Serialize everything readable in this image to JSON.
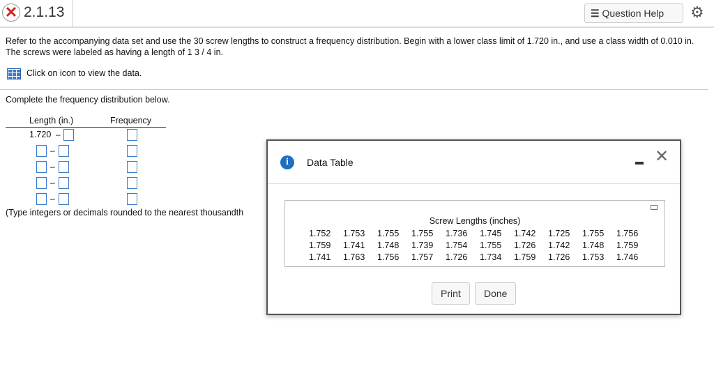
{
  "header": {
    "question_number": "2.1.13",
    "help_label": "Question Help"
  },
  "question": {
    "text": "Refer to the accompanying data set and use the 30 screw lengths to construct a frequency distribution. Begin with a lower class limit of 1.720 in., and use a class width of 0.010 in. The screws were labeled as having a length of 1 3 / 4 in.",
    "data_link": "Click on icon to view the data.",
    "instruction": "Complete the frequency distribution below.",
    "col_length": "Length (in.)",
    "col_frequency": "Frequency",
    "first_lower": "1.720",
    "dash": "–",
    "note": "(Type integers or decimals rounded to the nearest thousandth"
  },
  "dialog": {
    "title": "Data Table",
    "table_title": "Screw Lengths (inches)",
    "rows": [
      [
        "1.752",
        "1.753",
        "1.755",
        "1.755",
        "1.736",
        "1.745",
        "1.742",
        "1.725",
        "1.755",
        "1.756"
      ],
      [
        "1.759",
        "1.741",
        "1.748",
        "1.739",
        "1.754",
        "1.755",
        "1.726",
        "1.742",
        "1.748",
        "1.759"
      ],
      [
        "1.741",
        "1.763",
        "1.756",
        "1.757",
        "1.726",
        "1.734",
        "1.759",
        "1.726",
        "1.753",
        "1.746"
      ]
    ],
    "print_label": "Print",
    "done_label": "Done"
  }
}
